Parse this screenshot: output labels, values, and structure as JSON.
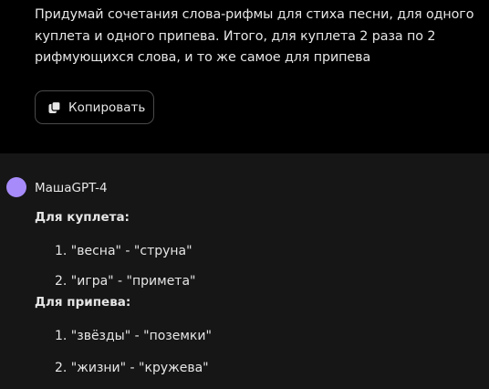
{
  "prompt": {
    "text": "Придумай сочетания слова-рифмы для стиха песни, для одного куплета и одного припева. Итого, для куплета 2 раза по 2 рифмующихся слова, и то же самое для припева",
    "copy_label": "Копировать",
    "copy_icon": "copy-icon"
  },
  "answer": {
    "model_name": "МашаGPT-4",
    "avatar_color": "#a78bfa",
    "sections": [
      {
        "heading": "Для куплета:",
        "items": [
          "1. \"весна\" - \"струна\"",
          "2. \"игра\" - \"примета\""
        ]
      },
      {
        "heading": "Для припева:",
        "items": [
          "1. \"звёзды\" - \"поземки\"",
          "2. \"жизни\" - \"кружева\""
        ]
      }
    ]
  },
  "colors": {
    "background_top": "#000000",
    "background_answer": "#161616",
    "text": "#e6e6e6",
    "button_border": "#4a4a4a"
  }
}
